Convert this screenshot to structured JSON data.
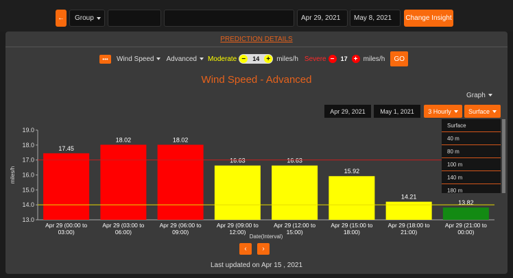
{
  "topbar": {
    "back_glyph": "←",
    "group_label": "Group",
    "start_date": "Apr 29, 2021",
    "end_date": "May 8, 2021",
    "change_insight": "Change Insight"
  },
  "prediction": {
    "title": "PREDICTION DETAILS",
    "menu_glyph": "•••",
    "parameter": "Wind Speed",
    "mode": "Advanced",
    "moderate_label": "Moderate",
    "moderate_value": "14",
    "severe_label": "Severe",
    "severe_value": "17",
    "unit": "miles/h",
    "go_label": "GO",
    "minus_glyph": "−",
    "plus_glyph": "+"
  },
  "chart_controls": {
    "view_label": "Graph",
    "from_date": "Apr 29, 2021",
    "to_date": "May 1, 2021",
    "interval": "3 Hourly",
    "level": "Surface",
    "level_options": [
      "Surface",
      "40 m",
      "80 m",
      "100 m",
      "140 m",
      "180 m"
    ]
  },
  "pagination": {
    "prev_glyph": "‹",
    "next_glyph": "›"
  },
  "footer": {
    "updated": "Last updated on Apr 15 , 2021"
  },
  "colors": {
    "severe": "#ff0000",
    "moderate": "#ffff00",
    "normal": "#138a13",
    "accent": "#f96a0d",
    "title": "#e6621c"
  },
  "chart_data": {
    "type": "bar",
    "title": "Wind Speed - Advanced",
    "xlabel": "Date(Interval)",
    "ylabel": "miles/h",
    "ylim": [
      13.0,
      19.0
    ],
    "yticks": [
      "13.0",
      "14.0",
      "15.0",
      "16.0",
      "17.0",
      "18.0",
      "19.0"
    ],
    "thresholds": {
      "moderate": 14,
      "severe": 17
    },
    "categories": [
      [
        "Apr 29 (00:00 to",
        "03:00)"
      ],
      [
        "Apr 29 (03:00 to",
        "06:00)"
      ],
      [
        "Apr 29 (06:00 to",
        "09:00)"
      ],
      [
        "Apr 29 (09:00 to",
        "12:00)"
      ],
      [
        "Apr 29 (12:00 to",
        "15:00)"
      ],
      [
        "Apr 29 (15:00 to",
        "18:00)"
      ],
      [
        "Apr 29 (18:00 to",
        "21:00)"
      ],
      [
        "Apr 29 (21:00 to",
        "00:00)"
      ]
    ],
    "values": [
      17.45,
      18.02,
      18.02,
      16.63,
      16.63,
      15.92,
      14.21,
      13.82
    ],
    "value_labels": [
      "17.45",
      "18.02",
      "18.02",
      "16.63",
      "16.63",
      "15.92",
      "14.21",
      "13.82"
    ],
    "bar_colors": [
      "#ff0000",
      "#ff0000",
      "#ff0000",
      "#ffff00",
      "#ffff00",
      "#ffff00",
      "#ffff00",
      "#138a13"
    ]
  }
}
